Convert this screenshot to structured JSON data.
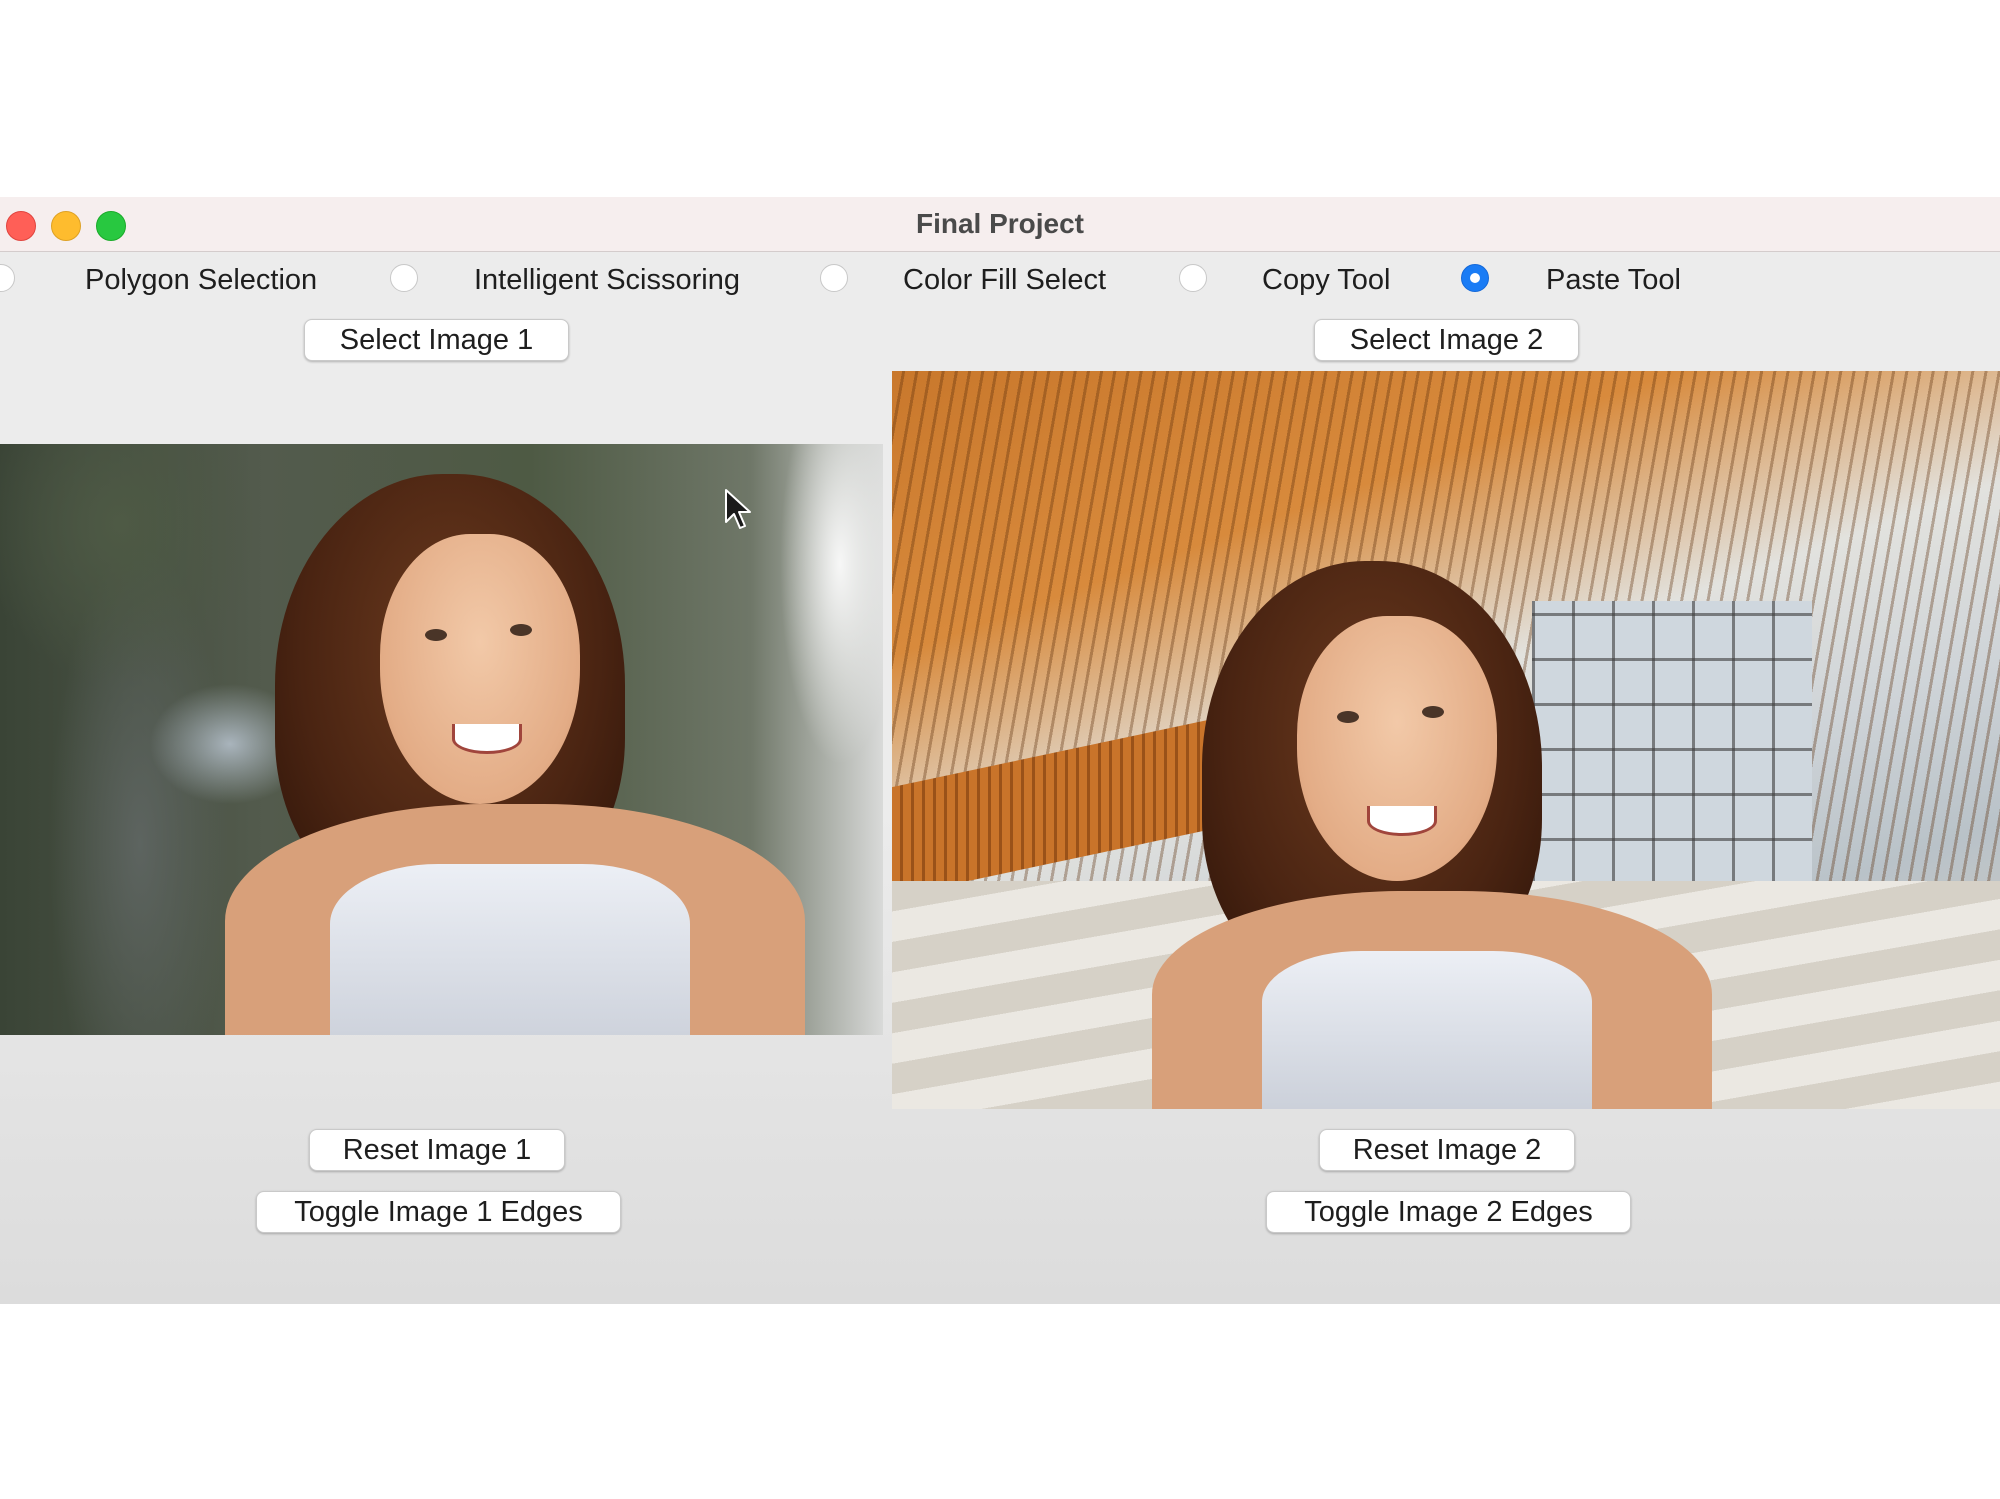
{
  "window": {
    "title": "Final Project"
  },
  "tools": [
    {
      "label": "Polygon Selection",
      "checked": false
    },
    {
      "label": "Intelligent Scissoring",
      "checked": false
    },
    {
      "label": "Color Fill Select",
      "checked": false
    },
    {
      "label": "Copy Tool",
      "checked": false
    },
    {
      "label": "Paste Tool",
      "checked": true
    }
  ],
  "left_panel": {
    "select_label": "Select Image 1",
    "reset_label": "Reset Image 1",
    "toggle_label": "Toggle Image 1 Edges"
  },
  "right_panel": {
    "select_label": "Select Image 2",
    "reset_label": "Reset Image 2",
    "toggle_label": "Toggle Image 2 Edges"
  },
  "colors": {
    "accent": "#1a7cf5",
    "close": "#ff5f57",
    "minimize": "#febc2e",
    "maximize": "#28c840"
  },
  "icons": {
    "cursor": "arrow-cursor-icon"
  }
}
